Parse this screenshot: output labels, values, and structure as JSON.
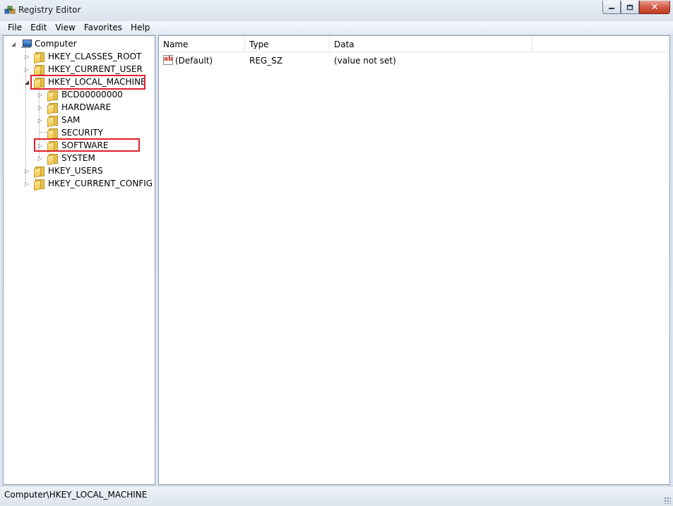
{
  "window": {
    "title": "Registry Editor",
    "close_glyph": "✕"
  },
  "menu": [
    "File",
    "Edit",
    "View",
    "Favorites",
    "Help"
  ],
  "tree": {
    "root": "Computer",
    "hives": [
      {
        "label": "HKEY_CLASSES_ROOT",
        "expanded": false
      },
      {
        "label": "HKEY_CURRENT_USER",
        "expanded": false
      },
      {
        "label": "HKEY_LOCAL_MACHINE",
        "expanded": true,
        "highlighted": true,
        "selected": true
      },
      {
        "label": "HKEY_USERS",
        "expanded": false
      },
      {
        "label": "HKEY_CURRENT_CONFIG",
        "expanded": false
      }
    ],
    "hklm_children": [
      {
        "label": "BCD00000000",
        "has_children": true
      },
      {
        "label": "HARDWARE",
        "has_children": true
      },
      {
        "label": "SAM",
        "has_children": true
      },
      {
        "label": "SECURITY",
        "has_children": false
      },
      {
        "label": "SOFTWARE",
        "has_children": true,
        "highlighted": true
      },
      {
        "label": "SYSTEM",
        "has_children": true
      }
    ],
    "highlight_color": "#e0202b"
  },
  "list": {
    "columns": [
      "Name",
      "Type",
      "Data"
    ],
    "rows": [
      {
        "name": "(Default)",
        "type": "REG_SZ",
        "data": "(value not set)",
        "icon": "string-value-icon"
      }
    ]
  },
  "status": {
    "path": "Computer\\HKEY_LOCAL_MACHINE"
  }
}
